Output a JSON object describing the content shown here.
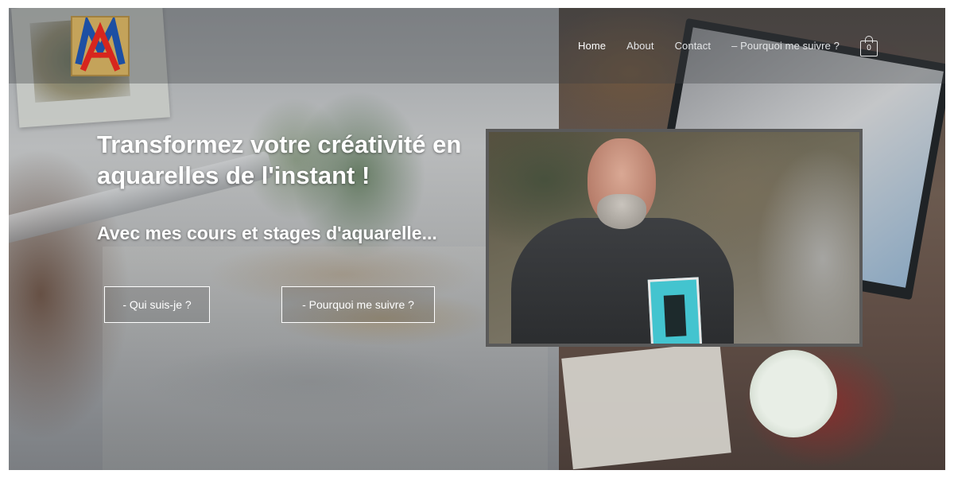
{
  "logo": {
    "alt": "AM logo"
  },
  "nav": {
    "items": [
      {
        "label": "Home",
        "active": true
      },
      {
        "label": "About",
        "active": false
      },
      {
        "label": "Contact",
        "active": false
      },
      {
        "label": "– Pourquoi me suivre ?",
        "active": false
      }
    ],
    "cart_count": "0"
  },
  "hero": {
    "title": "Transformez votre créativité en aquarelles de l'instant !",
    "subtitle": "Avec mes cours et stages d'aquarelle...",
    "buttons": {
      "who": "- Qui suis-je ?",
      "why": "- Pourquoi me suivre ?"
    }
  },
  "colors": {
    "logo_red": "#d7261e",
    "logo_blue": "#1d4fa3",
    "logo_gold": "#c4a35a",
    "text": "#ffffff"
  },
  "icons": {
    "cart": "shopping-bag-icon"
  }
}
